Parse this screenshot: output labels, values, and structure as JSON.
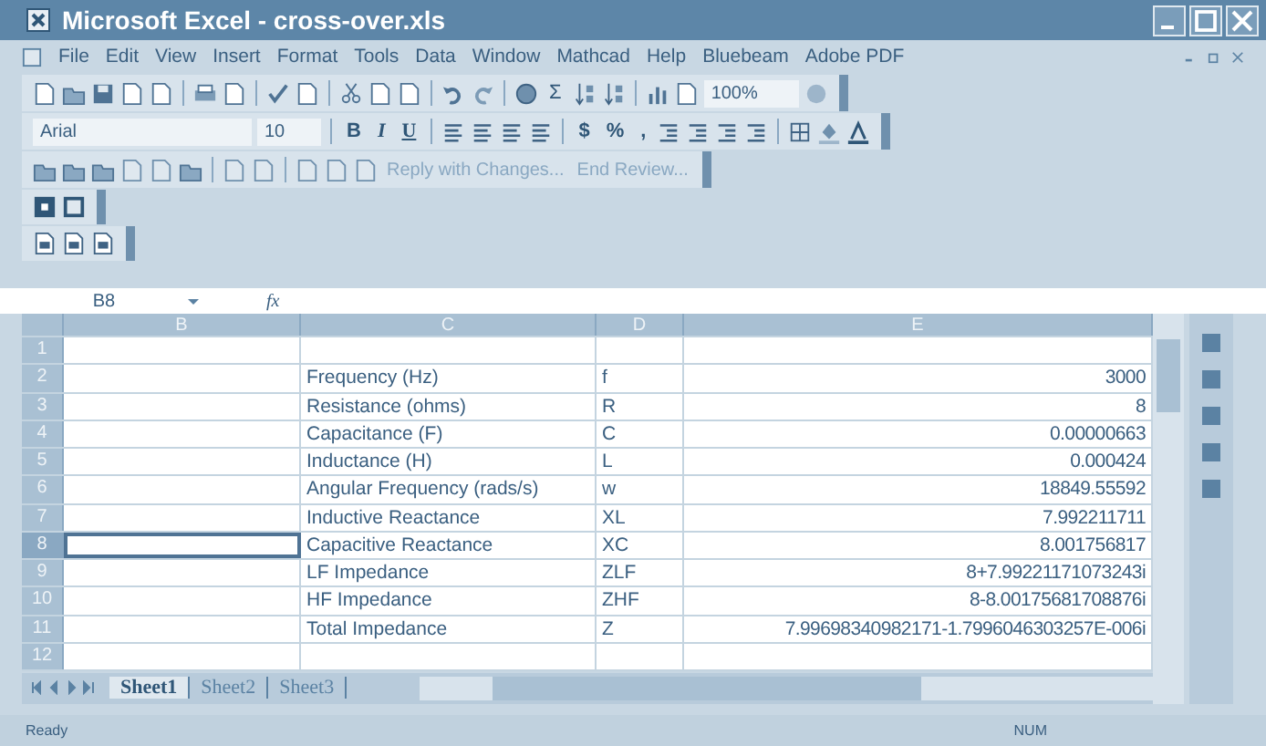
{
  "window": {
    "title": "Microsoft Excel - cross-over.xls"
  },
  "menu": [
    "File",
    "Edit",
    "View",
    "Insert",
    "Format",
    "Tools",
    "Data",
    "Window",
    "Mathcad",
    "Help",
    "Bluebeam",
    "Adobe PDF"
  ],
  "standard_toolbar": {
    "sigma": "Σ",
    "zoom": "100%"
  },
  "formatting_toolbar": {
    "font": "Arial",
    "size": "10",
    "bold": "B",
    "italic": "I",
    "underline": "U",
    "currency": "$",
    "percent": "%",
    "comma": ","
  },
  "reviewing_toolbar": {
    "reply": "Reply with Changes...",
    "end_review": "End Review..."
  },
  "formula_bar": {
    "name_box": "B8",
    "function_label": "fx"
  },
  "columns": [
    "B",
    "C",
    "D",
    "E"
  ],
  "rows": [
    {
      "number": "1",
      "selected": false
    },
    {
      "number": "2",
      "c": "Frequency (Hz)",
      "d": "f",
      "e": "3000",
      "selected": false
    },
    {
      "number": "3",
      "c": "Resistance (ohms)",
      "d": "R",
      "e": "8",
      "selected": false
    },
    {
      "number": "4",
      "c": "Capacitance (F)",
      "d": "C",
      "e": "0.00000663",
      "selected": false
    },
    {
      "number": "5",
      "c": "Inductance (H)",
      "d": "L",
      "e": "0.000424",
      "selected": false
    },
    {
      "number": "6",
      "c": "Angular Frequency (rads/s)",
      "d": "w",
      "e": "18849.55592",
      "selected": false
    },
    {
      "number": "7",
      "c": "Inductive Reactance",
      "d": "XL",
      "e": "7.992211711",
      "selected": false
    },
    {
      "number": "8",
      "c": "Capacitive Reactance",
      "d": "XC",
      "e": "8.001756817",
      "selected": true
    },
    {
      "number": "9",
      "c": "LF Impedance",
      "d": "ZLF",
      "e": "8+7.99221171073243i",
      "selected": false
    },
    {
      "number": "10",
      "c": "HF Impedance",
      "d": "ZHF",
      "e": "8-8.00175681708876i",
      "selected": false
    },
    {
      "number": "11",
      "c": "Total Impedance",
      "d": "Z",
      "e": "7.99698340982171-1.7996046303257E-006i",
      "selected": false
    },
    {
      "number": "12",
      "selected": false
    }
  ],
  "sheet_tabs": [
    {
      "label": "Sheet1",
      "selected": true
    },
    {
      "label": "Sheet2",
      "selected": false
    },
    {
      "label": "Sheet3",
      "selected": false
    }
  ],
  "status_bar": {
    "status": "Ready",
    "num_lock": "NUM"
  }
}
